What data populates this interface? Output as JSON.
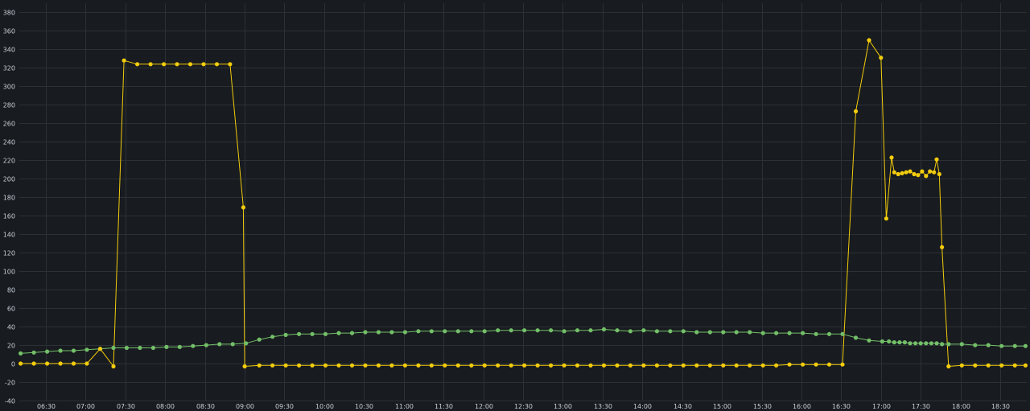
{
  "colors": {
    "background": "#181b1f",
    "grid": "#2c3137",
    "tick_text": "#c7d0d9",
    "series_yellow": "#f2cc0c",
    "series_green": "#73bf69"
  },
  "chart_data": {
    "type": "line",
    "title": "",
    "xlabel": "",
    "ylabel": "",
    "grid": true,
    "legend": "none",
    "xlim": [
      "06:10",
      "18:50"
    ],
    "ylim": [
      -40,
      390
    ],
    "y_ticks": [
      "-40",
      "-20",
      "0",
      "20",
      "40",
      "60",
      "80",
      "100",
      "120",
      "140",
      "160",
      "180",
      "200",
      "220",
      "240",
      "260",
      "280",
      "300",
      "320",
      "340",
      "360",
      "380"
    ],
    "x_ticks": [
      "06:30",
      "07:00",
      "07:30",
      "08:00",
      "08:30",
      "09:00",
      "09:30",
      "10:00",
      "10:30",
      "11:00",
      "11:30",
      "12:00",
      "12:30",
      "13:00",
      "13:30",
      "14:00",
      "14:30",
      "15:00",
      "15:30",
      "16:00",
      "16:30",
      "17:00",
      "17:30",
      "18:00",
      "18:30"
    ],
    "series": [
      {
        "color": "#f2cc0c",
        "points": [
          [
            "06:11",
            0
          ],
          [
            "06:21",
            0
          ],
          [
            "06:31",
            0
          ],
          [
            "06:41",
            0
          ],
          [
            "06:51",
            0
          ],
          [
            "07:01",
            0
          ],
          [
            "07:11",
            16
          ],
          [
            "07:21",
            -3
          ],
          [
            "07:29",
            328
          ],
          [
            "07:39",
            324
          ],
          [
            "07:49",
            324
          ],
          [
            "07:59",
            324
          ],
          [
            "08:09",
            324
          ],
          [
            "08:19",
            324
          ],
          [
            "08:29",
            324
          ],
          [
            "08:39",
            324
          ],
          [
            "08:49",
            324
          ],
          [
            "08:59",
            169
          ],
          [
            "09:00",
            -3
          ],
          [
            "09:11",
            -2
          ],
          [
            "09:21",
            -2
          ],
          [
            "09:31",
            -2
          ],
          [
            "09:41",
            -2
          ],
          [
            "09:51",
            -2
          ],
          [
            "10:01",
            -2
          ],
          [
            "10:11",
            -2
          ],
          [
            "10:21",
            -2
          ],
          [
            "10:31",
            -2
          ],
          [
            "10:41",
            -2
          ],
          [
            "10:51",
            -2
          ],
          [
            "11:01",
            -2
          ],
          [
            "11:11",
            -2
          ],
          [
            "11:21",
            -2
          ],
          [
            "11:31",
            -2
          ],
          [
            "11:41",
            -2
          ],
          [
            "11:51",
            -2
          ],
          [
            "12:01",
            -2
          ],
          [
            "12:11",
            -2
          ],
          [
            "12:21",
            -2
          ],
          [
            "12:31",
            -2
          ],
          [
            "12:41",
            -2
          ],
          [
            "12:51",
            -2
          ],
          [
            "13:01",
            -2
          ],
          [
            "13:11",
            -2
          ],
          [
            "13:21",
            -2
          ],
          [
            "13:31",
            -2
          ],
          [
            "13:41",
            -2
          ],
          [
            "13:51",
            -2
          ],
          [
            "14:01",
            -2
          ],
          [
            "14:11",
            -2
          ],
          [
            "14:21",
            -2
          ],
          [
            "14:31",
            -2
          ],
          [
            "14:41",
            -2
          ],
          [
            "14:51",
            -2
          ],
          [
            "15:01",
            -2
          ],
          [
            "15:11",
            -2
          ],
          [
            "15:21",
            -2
          ],
          [
            "15:31",
            -2
          ],
          [
            "15:41",
            -2
          ],
          [
            "15:51",
            -1
          ],
          [
            "16:01",
            -1
          ],
          [
            "16:11",
            -1
          ],
          [
            "16:21",
            -1
          ],
          [
            "16:31",
            -1
          ],
          [
            "16:41",
            273
          ],
          [
            "16:51",
            350
          ],
          [
            "17:00",
            331
          ],
          [
            "17:04",
            157
          ],
          [
            "17:08",
            223
          ],
          [
            "17:10",
            207
          ],
          [
            "17:13",
            205
          ],
          [
            "17:16",
            206
          ],
          [
            "17:19",
            207
          ],
          [
            "17:22",
            208
          ],
          [
            "17:25",
            205
          ],
          [
            "17:28",
            204
          ],
          [
            "17:31",
            208
          ],
          [
            "17:34",
            203
          ],
          [
            "17:37",
            208
          ],
          [
            "17:40",
            207
          ],
          [
            "17:42",
            221
          ],
          [
            "17:44",
            205
          ],
          [
            "17:46",
            126
          ],
          [
            "17:51",
            -3
          ],
          [
            "18:01",
            -2
          ],
          [
            "18:11",
            -2
          ],
          [
            "18:21",
            -2
          ],
          [
            "18:31",
            -2
          ],
          [
            "18:41",
            -2
          ],
          [
            "18:49",
            -2
          ]
        ]
      },
      {
        "color": "#73bf69",
        "points": [
          [
            "06:11",
            11
          ],
          [
            "06:21",
            12
          ],
          [
            "06:31",
            13
          ],
          [
            "06:41",
            14
          ],
          [
            "06:51",
            14
          ],
          [
            "07:01",
            15
          ],
          [
            "07:11",
            16
          ],
          [
            "07:21",
            17
          ],
          [
            "07:31",
            17
          ],
          [
            "07:41",
            17
          ],
          [
            "07:51",
            17
          ],
          [
            "08:01",
            18
          ],
          [
            "08:11",
            18
          ],
          [
            "08:21",
            19
          ],
          [
            "08:31",
            20
          ],
          [
            "08:41",
            21
          ],
          [
            "08:51",
            21
          ],
          [
            "09:01",
            22
          ],
          [
            "09:11",
            26
          ],
          [
            "09:21",
            29
          ],
          [
            "09:31",
            31
          ],
          [
            "09:41",
            32
          ],
          [
            "09:51",
            32
          ],
          [
            "10:01",
            32
          ],
          [
            "10:11",
            33
          ],
          [
            "10:21",
            33
          ],
          [
            "10:31",
            34
          ],
          [
            "10:41",
            34
          ],
          [
            "10:51",
            34
          ],
          [
            "11:01",
            34
          ],
          [
            "11:11",
            35
          ],
          [
            "11:21",
            35
          ],
          [
            "11:31",
            35
          ],
          [
            "11:41",
            35
          ],
          [
            "11:51",
            35
          ],
          [
            "12:01",
            35
          ],
          [
            "12:11",
            36
          ],
          [
            "12:21",
            36
          ],
          [
            "12:31",
            36
          ],
          [
            "12:41",
            36
          ],
          [
            "12:51",
            36
          ],
          [
            "13:01",
            35
          ],
          [
            "13:11",
            36
          ],
          [
            "13:21",
            36
          ],
          [
            "13:31",
            37
          ],
          [
            "13:41",
            36
          ],
          [
            "13:51",
            35
          ],
          [
            "14:01",
            36
          ],
          [
            "14:11",
            35
          ],
          [
            "14:21",
            35
          ],
          [
            "14:31",
            35
          ],
          [
            "14:41",
            34
          ],
          [
            "14:51",
            34
          ],
          [
            "15:01",
            34
          ],
          [
            "15:11",
            34
          ],
          [
            "15:21",
            34
          ],
          [
            "15:31",
            33
          ],
          [
            "15:41",
            33
          ],
          [
            "15:51",
            33
          ],
          [
            "16:01",
            33
          ],
          [
            "16:11",
            32
          ],
          [
            "16:21",
            32
          ],
          [
            "16:31",
            32
          ],
          [
            "16:41",
            28
          ],
          [
            "16:51",
            25
          ],
          [
            "17:01",
            24
          ],
          [
            "17:06",
            24
          ],
          [
            "17:10",
            23
          ],
          [
            "17:14",
            23
          ],
          [
            "17:18",
            23
          ],
          [
            "17:22",
            22
          ],
          [
            "17:26",
            22
          ],
          [
            "17:30",
            22
          ],
          [
            "17:34",
            22
          ],
          [
            "17:38",
            22
          ],
          [
            "17:42",
            22
          ],
          [
            "17:46",
            21
          ],
          [
            "17:51",
            21
          ],
          [
            "18:01",
            21
          ],
          [
            "18:11",
            20
          ],
          [
            "18:21",
            20
          ],
          [
            "18:31",
            19
          ],
          [
            "18:41",
            19
          ],
          [
            "18:49",
            19
          ]
        ]
      }
    ]
  }
}
